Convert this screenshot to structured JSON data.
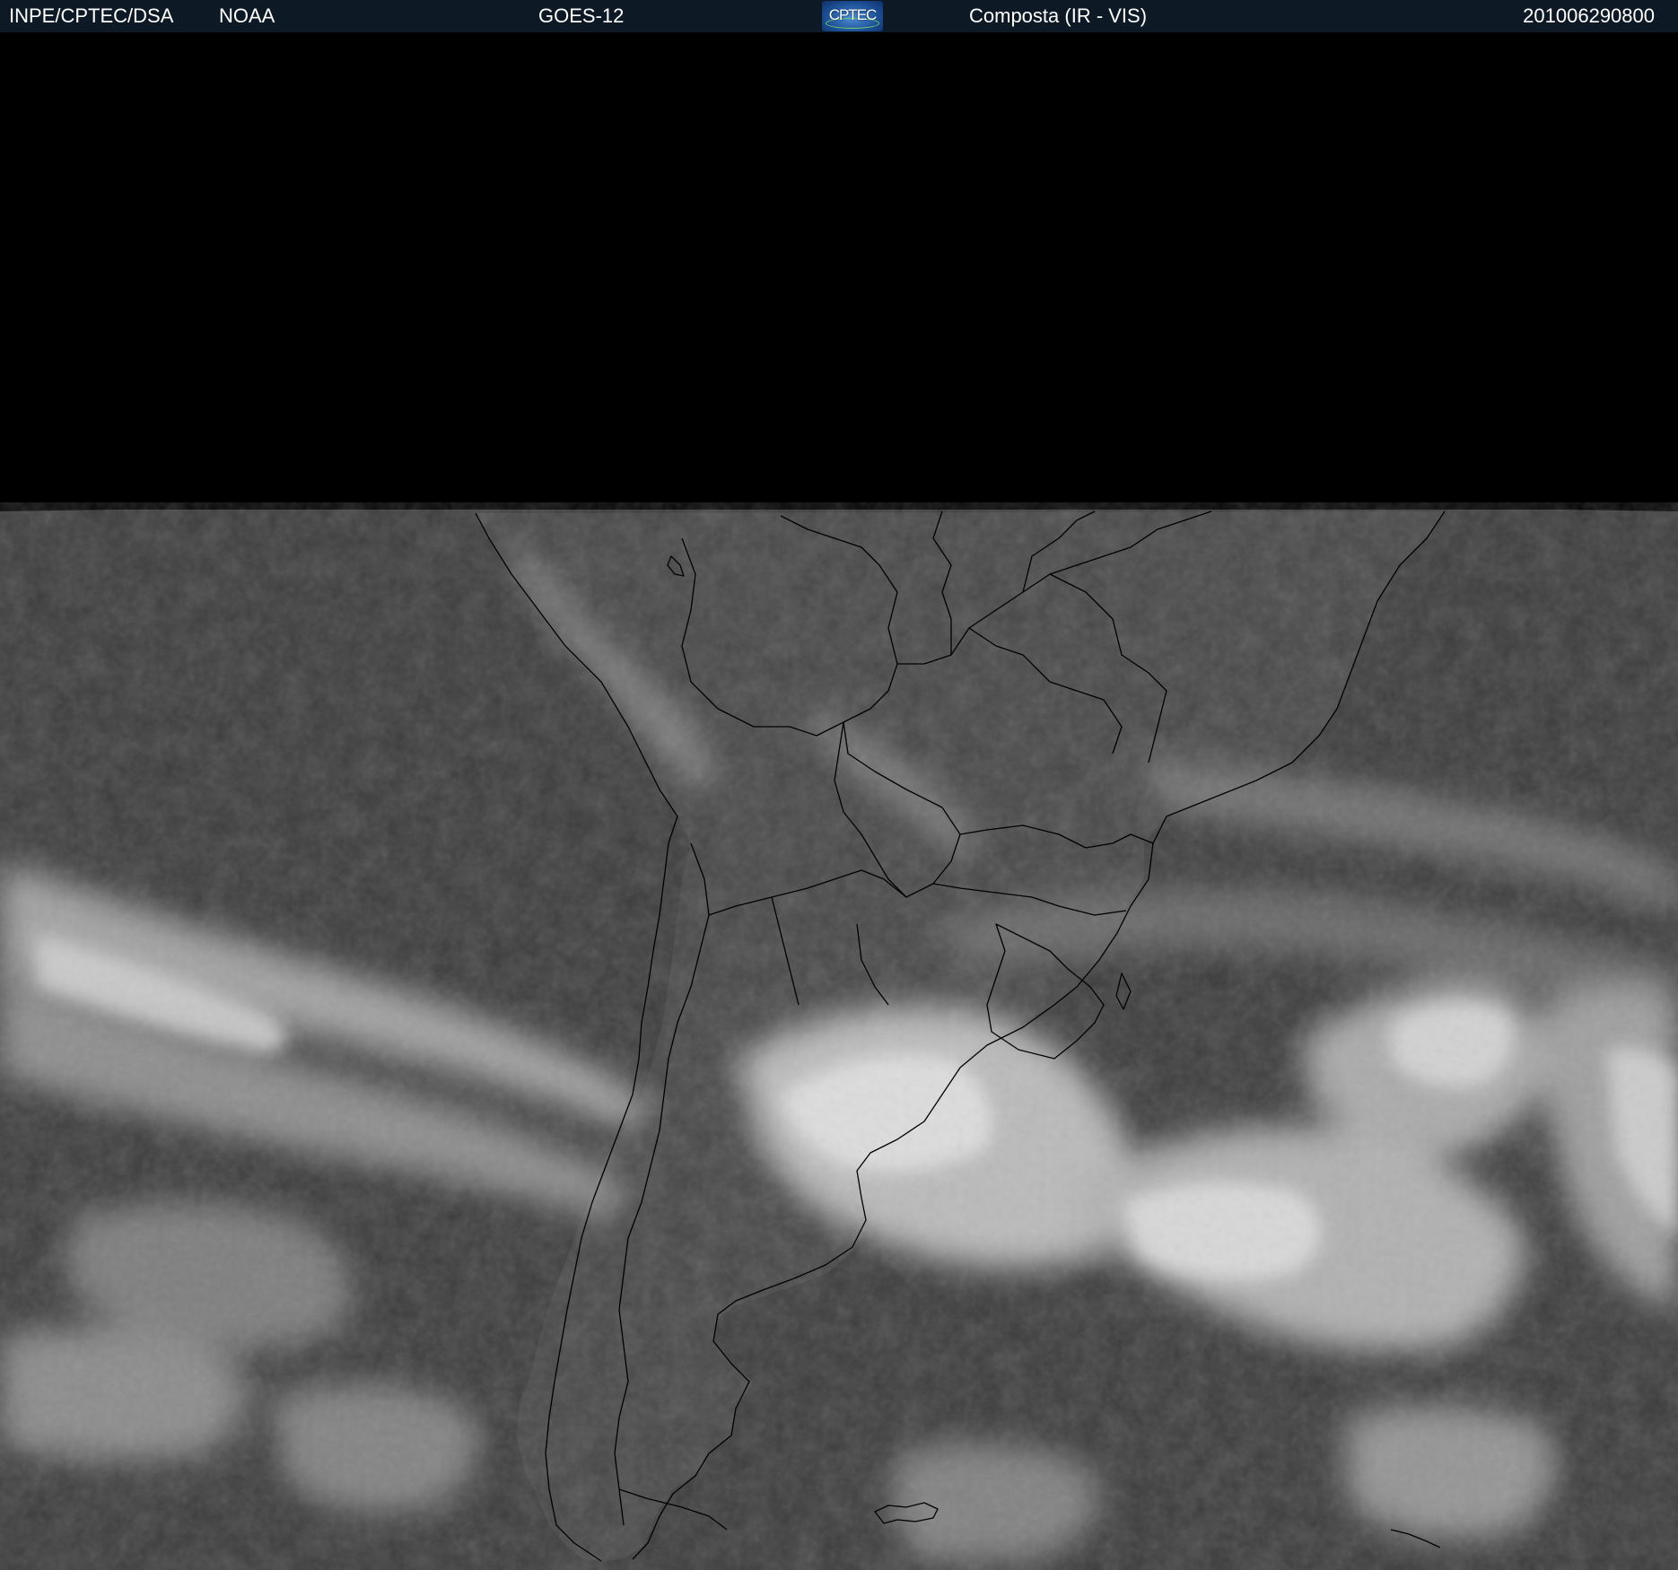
{
  "header": {
    "org": "INPE/CPTEC/DSA",
    "agency": "NOAA",
    "satellite": "GOES-12",
    "logo_text": "CPTEC",
    "product": "Composta (IR - VIS)",
    "timestamp": "201006290800"
  },
  "colors": {
    "header_bg": "#0d1a26",
    "space": "#000000",
    "ocean": "#3a3a3a",
    "land": "#454545",
    "cloud": "#d8d8d8",
    "borders": "#000000"
  },
  "icons": {
    "logo": "cptec-logo"
  }
}
